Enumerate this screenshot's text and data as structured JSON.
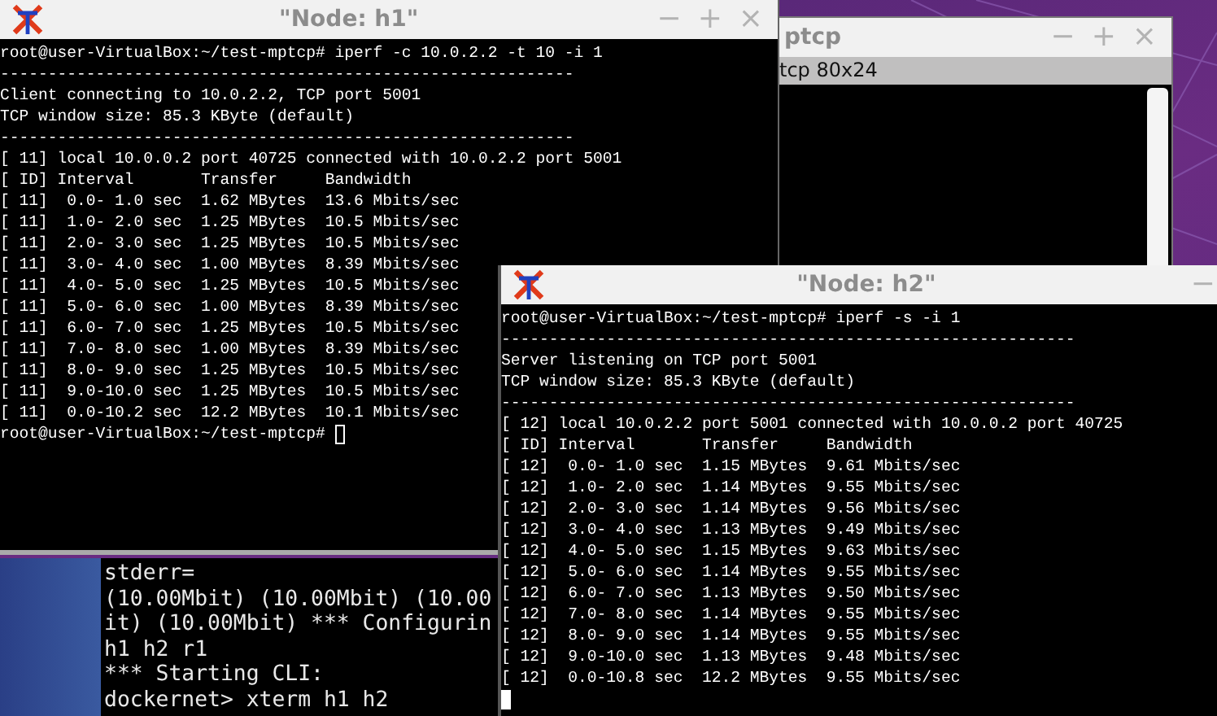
{
  "windows": [
    {
      "kind": "tabbed",
      "title": "ptcp",
      "controls": [
        "−",
        "+",
        "×"
      ],
      "tab_label": "tcp 80x24"
    },
    {
      "kind": "xterm",
      "title": "\"Node: h1\"",
      "controls": [
        "−",
        "+",
        "×"
      ],
      "lines": [
        "root@user-VirtualBox:~/test-mptcp# iperf -c 10.0.2.2 -t 10 -i 1",
        "------------------------------------------------------------",
        "Client connecting to 10.0.2.2, TCP port 5001",
        "TCP window size: 85.3 KByte (default)",
        "------------------------------------------------------------",
        "[ 11] local 10.0.0.2 port 40725 connected with 10.0.2.2 port 5001",
        "[ ID] Interval       Transfer     Bandwidth",
        "[ 11]  0.0- 1.0 sec  1.62 MBytes  13.6 Mbits/sec",
        "[ 11]  1.0- 2.0 sec  1.25 MBytes  10.5 Mbits/sec",
        "[ 11]  2.0- 3.0 sec  1.25 MBytes  10.5 Mbits/sec",
        "[ 11]  3.0- 4.0 sec  1.00 MBytes  8.39 Mbits/sec",
        "[ 11]  4.0- 5.0 sec  1.25 MBytes  10.5 Mbits/sec",
        "[ 11]  5.0- 6.0 sec  1.00 MBytes  8.39 Mbits/sec",
        "[ 11]  6.0- 7.0 sec  1.25 MBytes  10.5 Mbits/sec",
        "[ 11]  7.0- 8.0 sec  1.00 MBytes  8.39 Mbits/sec",
        "[ 11]  8.0- 9.0 sec  1.25 MBytes  10.5 Mbits/sec",
        "[ 11]  9.0-10.0 sec  1.25 MBytes  10.5 Mbits/sec",
        "[ 11]  0.0-10.2 sec  12.2 MBytes  10.1 Mbits/sec",
        "root@user-VirtualBox:~/test-mptcp#"
      ],
      "cursor": {
        "focused": false,
        "on_new_line": false
      }
    },
    {
      "kind": "xterm",
      "title": "\"Node: h2\"",
      "controls": [
        "−"
      ],
      "lines": [
        "root@user-VirtualBox:~/test-mptcp# iperf -s -i 1",
        "------------------------------------------------------------",
        "Server listening on TCP port 5001",
        "TCP window size: 85.3 KByte (default)",
        "------------------------------------------------------------",
        "[ 12] local 10.0.2.2 port 5001 connected with 10.0.0.2 port 40725",
        "[ ID] Interval       Transfer     Bandwidth",
        "[ 12]  0.0- 1.0 sec  1.15 MBytes  9.61 Mbits/sec",
        "[ 12]  1.0- 2.0 sec  1.14 MBytes  9.55 Mbits/sec",
        "[ 12]  2.0- 3.0 sec  1.14 MBytes  9.56 Mbits/sec",
        "[ 12]  3.0- 4.0 sec  1.13 MBytes  9.49 Mbits/sec",
        "[ 12]  4.0- 5.0 sec  1.15 MBytes  9.63 Mbits/sec",
        "[ 12]  5.0- 6.0 sec  1.14 MBytes  9.55 Mbits/sec",
        "[ 12]  6.0- 7.0 sec  1.13 MBytes  9.50 Mbits/sec",
        "[ 12]  7.0- 8.0 sec  1.14 MBytes  9.55 Mbits/sec",
        "[ 12]  8.0- 9.0 sec  1.14 MBytes  9.55 Mbits/sec",
        "[ 12]  9.0-10.0 sec  1.13 MBytes  9.48 Mbits/sec",
        "[ 12]  0.0-10.8 sec  12.2 MBytes  9.55 Mbits/sec"
      ],
      "cursor": {
        "focused": true,
        "on_new_line": true
      }
    },
    {
      "kind": "console",
      "lines": [
        "stderr=",
        "(10.00Mbit) (10.00Mbit) (10.00",
        "it) (10.00Mbit) *** Configurin",
        "h1 h2 r1",
        "*** Starting CLI:",
        "dockernet> xterm h1 h2"
      ]
    }
  ]
}
